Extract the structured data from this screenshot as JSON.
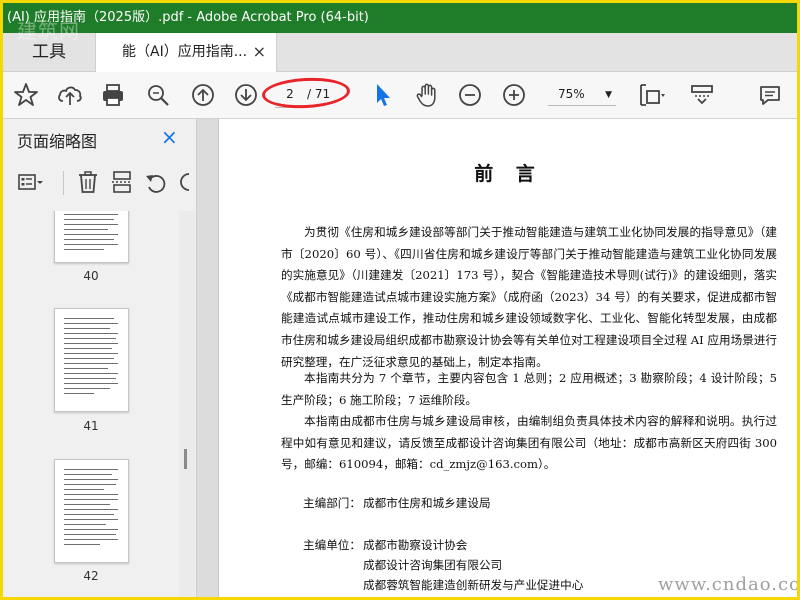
{
  "window": {
    "title": "(AI) 应用指南（2025版）.pdf - Adobe Acrobat Pro (64-bit)"
  },
  "tabs": {
    "tools": "工具",
    "document": "能（AI）应用指南...",
    "close": "×"
  },
  "toolbar": {
    "current_page": "2",
    "total_pages": "/ 71",
    "zoom": "75%"
  },
  "thumbnails": {
    "panel_title": "页面缩略图",
    "close": "×",
    "pages": [
      "40",
      "41",
      "42"
    ]
  },
  "document": {
    "title": "前 言",
    "paragraphs": [
      "为贯彻《住房和城乡建设部等部门关于推动智能建造与建筑工业化协同发展的指导意见》（建市〔2020〕60 号）、《四川省住房和城乡建设厅等部门关于推动智能建造与建筑工业化协同发展的实施意见》（川建建发〔2021〕173 号），契合《智能建造技术导则(试行)》的建设细则，落实《成都市智能建造试点城市建设实施方案》（成府函（2023）34 号）的有关要求，促进成都市智能建造试点城市建设工作，推动住房和城乡建设领域数字化、工业化、智能化转型发展，由成都市住房和城乡建设局组织成都市勘察设计协会等有关单位对工程建设项目全过程 AI 应用场景进行研究整理，在广泛征求意见的基础上，制定本指南。",
      "本指南共分为 7 个章节，主要内容包含 1 总则；2 应用概述；3 勘察阶段；4 设计阶段；5 生产阶段；6 施工阶段；7 运维阶段。",
      "本指南由成都市住房与城乡建设局审核，由编制组负责具体技术内容的解释和说明。执行过程中如有意见和建议，请反馈至成都设计咨询集团有限公司（地址：成都市高新区天府四街 300 号，邮编：610094，邮箱：cd_zmjz@163.com）。"
    ],
    "editor_label": "主编部门：",
    "editor_value": "成都市住房和城乡建设局",
    "host_label": "主编单位：",
    "host_units": [
      "成都市勘察设计协会",
      "成都设计咨询集团有限公司",
      "成都蓉筑智能建造创新研发与产业促进中心"
    ]
  },
  "watermarks": {
    "top_left": "建筑网",
    "bottom_right": "www.cndao.com"
  }
}
